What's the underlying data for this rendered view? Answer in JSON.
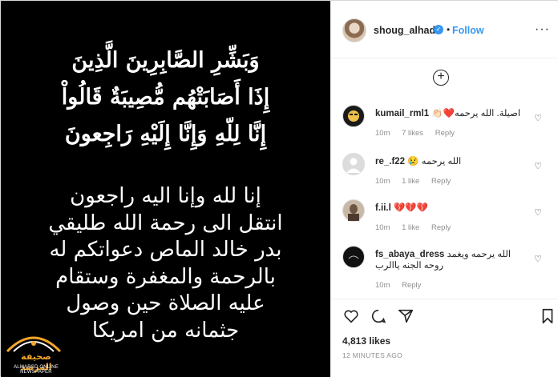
{
  "post": {
    "verse_lines": [
      "وَبَشِّرِ الصَّابِرِينَ الَّذِينَ",
      "إِذَا أَصَابَتْهُم مُّصِيبَةٌ قَالُواْ",
      "إِنَّا لِلّهِ وَإِنَّا إِلَيْهِ رَاجِعونَ"
    ],
    "announce_lines": [
      "إنا لله وإنا اليه راجعون",
      "انتقل الى رحمة الله طليقي",
      "بدر خالد الماص دعواتكم له",
      "بالرحمة والمغفرة وستقام",
      "عليه الصلاة حين وصول",
      "جثمانه من امريكا"
    ],
    "watermark": {
      "name": "صحيفة المرصد",
      "sub": "ALMARSD ONLINE NEWSPAPER"
    }
  },
  "header": {
    "username": "shoug_alhadii",
    "verified_icon": "check-icon",
    "dot": "•",
    "follow_label": "Follow",
    "more_icon": "ellipsis-icon"
  },
  "load_more_icon": "plus-circle-icon",
  "comments": [
    {
      "username": "kumail_rml1",
      "text": "اصيلة. الله يرحمه❤️👏🏻",
      "time": "10m",
      "likes": "7 likes",
      "reply": "Reply",
      "avatar_color": "#1a1a1a"
    },
    {
      "username": "re_.f22",
      "text": "الله يرحمه 😢",
      "time": "10m",
      "likes": "1 like",
      "reply": "Reply",
      "avatar_color": "#dcdcdc"
    },
    {
      "username": "f.ii.l",
      "text": "💔💔💔",
      "time": "10m",
      "likes": "1 like",
      "reply": "Reply",
      "avatar_color": "#c9b8a6"
    },
    {
      "username": "fs_abaya_dress",
      "text": "الله يرحمه ويغمد روحه الجنه ياالرب",
      "time": "10m",
      "likes": "",
      "reply": "Reply",
      "avatar_color": "#111111"
    }
  ],
  "actions": {
    "like_icon": "heart-icon",
    "comment_icon": "comment-icon",
    "share_icon": "share-icon",
    "save_icon": "bookmark-icon"
  },
  "likes_count": "4,813 likes",
  "time_ago": "12 MINUTES AGO"
}
